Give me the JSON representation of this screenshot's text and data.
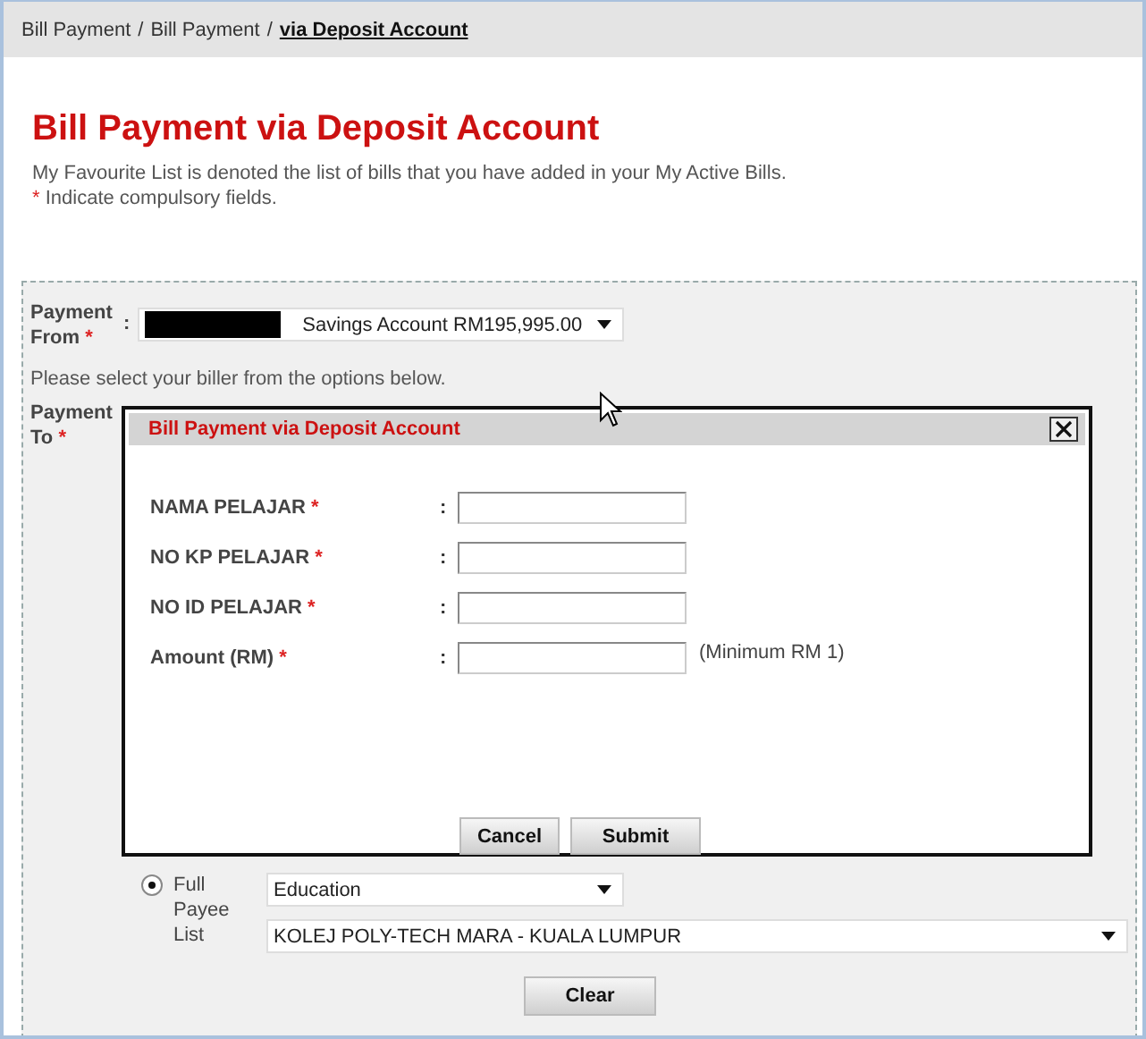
{
  "breadcrumb": [
    {
      "kind": "link",
      "text": "Bill Payment"
    },
    {
      "kind": "separator",
      "text": "/"
    },
    {
      "kind": "link",
      "text": "Bill Payment"
    },
    {
      "kind": "separator",
      "text": "/"
    },
    {
      "kind": "current",
      "text": "via Deposit Account"
    }
  ],
  "title": "Bill Payment via Deposit Account",
  "intro": "My Favourite List is denoted the list of bills that you have added in your My Active Bills.",
  "compulsory_note": {
    "mark": "*",
    "text": "Indicate compulsory fields."
  },
  "payment_from": {
    "label": "Payment From",
    "mark": "*",
    "colon": ":",
    "value": "Savings Account RM195,995.00"
  },
  "hint": "Please select your biller from the options below.",
  "payment_to": {
    "label": "Payment To",
    "mark": "*"
  },
  "payee_option": {
    "label": "Full Payee List",
    "selected": true,
    "category": "Education",
    "payee": "KOLEJ POLY-TECH MARA - KUALA LUMPUR"
  },
  "clear_button": "Clear",
  "modal": {
    "title": "Bill Payment via Deposit Account",
    "fields": [
      {
        "label": "NAMA PELAJAR",
        "mark": "*",
        "colon": ":"
      },
      {
        "label": "NO KP PELAJAR",
        "mark": "*",
        "colon": ":"
      },
      {
        "label": "NO ID PELAJAR",
        "mark": "*",
        "colon": ":"
      },
      {
        "label": "Amount (RM)",
        "mark": "*",
        "colon": ":",
        "note": "(Minimum RM 1)"
      }
    ],
    "buttons": [
      "Cancel",
      "Submit"
    ]
  }
}
